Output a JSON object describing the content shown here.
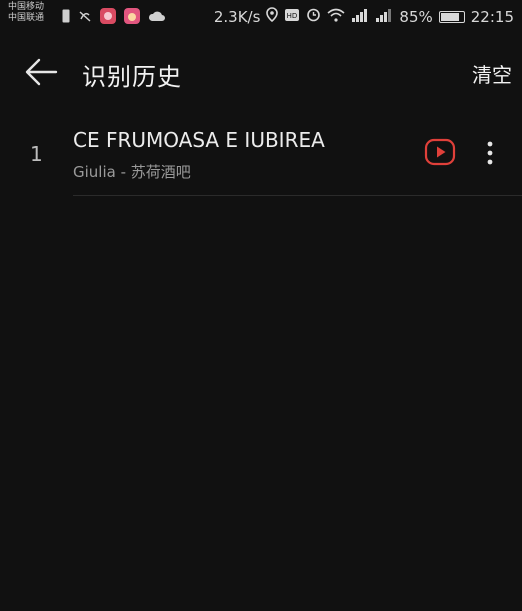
{
  "status_bar": {
    "carrier_1": "中国移动",
    "carrier_2": "中国联通",
    "net_speed": "2.3K/s",
    "battery": "85%",
    "time": "22:15"
  },
  "header": {
    "title": "识别历史",
    "clear_label": "清空"
  },
  "history": [
    {
      "index": "1",
      "title": "CE FRUMOASA E IUBIREA",
      "subtitle": "Giulia - 苏荷酒吧"
    }
  ],
  "colors": {
    "background": "#111111",
    "play_accent": "#e0403a"
  },
  "icons": {
    "back": "arrow-left-icon",
    "play": "youtube-play-icon",
    "more": "more-vertical-icon"
  }
}
